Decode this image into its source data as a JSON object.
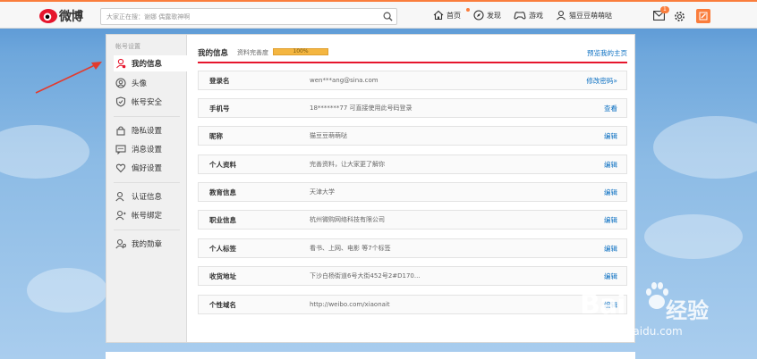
{
  "topbar": {
    "logo_text": "微博",
    "search_placeholder": "大家正在搜：谢娜 偶露歌神啊",
    "nav": [
      {
        "label": "首页",
        "icon": "home-icon"
      },
      {
        "label": "发现",
        "icon": "discover-icon"
      },
      {
        "label": "游戏",
        "icon": "game-icon"
      },
      {
        "label": "猫豆豆萌萌哒",
        "icon": "user-icon"
      }
    ],
    "mail_badge": "1"
  },
  "sidebar": {
    "title": "帐号设置",
    "items": [
      {
        "label": "我的信息",
        "icon": "user-info-icon",
        "active": true
      },
      {
        "label": "头像",
        "icon": "avatar-icon"
      },
      {
        "label": "帐号安全",
        "icon": "shield-icon"
      },
      {
        "label": "隐私设置",
        "icon": "lock-icon"
      },
      {
        "label": "消息设置",
        "icon": "message-icon"
      },
      {
        "label": "偏好设置",
        "icon": "heart-icon"
      },
      {
        "label": "认证信息",
        "icon": "verify-icon"
      },
      {
        "label": "帐号绑定",
        "icon": "bind-icon"
      },
      {
        "label": "我的勋章",
        "icon": "medal-icon"
      }
    ]
  },
  "main": {
    "title": "我的信息",
    "completion_label": "资料完善度",
    "completion_percent": "100%",
    "completion_value": 1.0,
    "preview_link": "预览我的主页",
    "rows": [
      {
        "label": "登录名",
        "value": "wen***ang@sina.com",
        "action": "修改密码»"
      },
      {
        "label": "手机号",
        "value": "18*******77 可直接使用此号码登录",
        "action": "查看"
      },
      {
        "label": "昵称",
        "value": "猫豆豆萌萌哒",
        "action": "编辑"
      },
      {
        "label": "个人资料",
        "value": "完善资料，让大家更了解你",
        "action": "编辑"
      },
      {
        "label": "教育信息",
        "value": "天津大学",
        "action": "编辑"
      },
      {
        "label": "职业信息",
        "value": "杭州微购网络科技有限公司",
        "action": "编辑"
      },
      {
        "label": "个人标签",
        "value": "看书、上网、电影 等7个标签",
        "action": "编辑"
      },
      {
        "label": "收货地址",
        "value": "下沙白杨街道6号大街452号2#D170...",
        "action": "编辑"
      },
      {
        "label": "个性域名",
        "value": "http://weibo.com/xiaonait",
        "action": "编辑"
      }
    ]
  },
  "watermark": {
    "brand": "Bai",
    "brand_cn": "经验",
    "url": "jingyan.baidu.com"
  },
  "colors": {
    "accent_orange": "#fa7d3c",
    "weibo_red": "#e6162d",
    "link_blue": "#0a6fc2",
    "progress_yellow": "#f4b641"
  }
}
